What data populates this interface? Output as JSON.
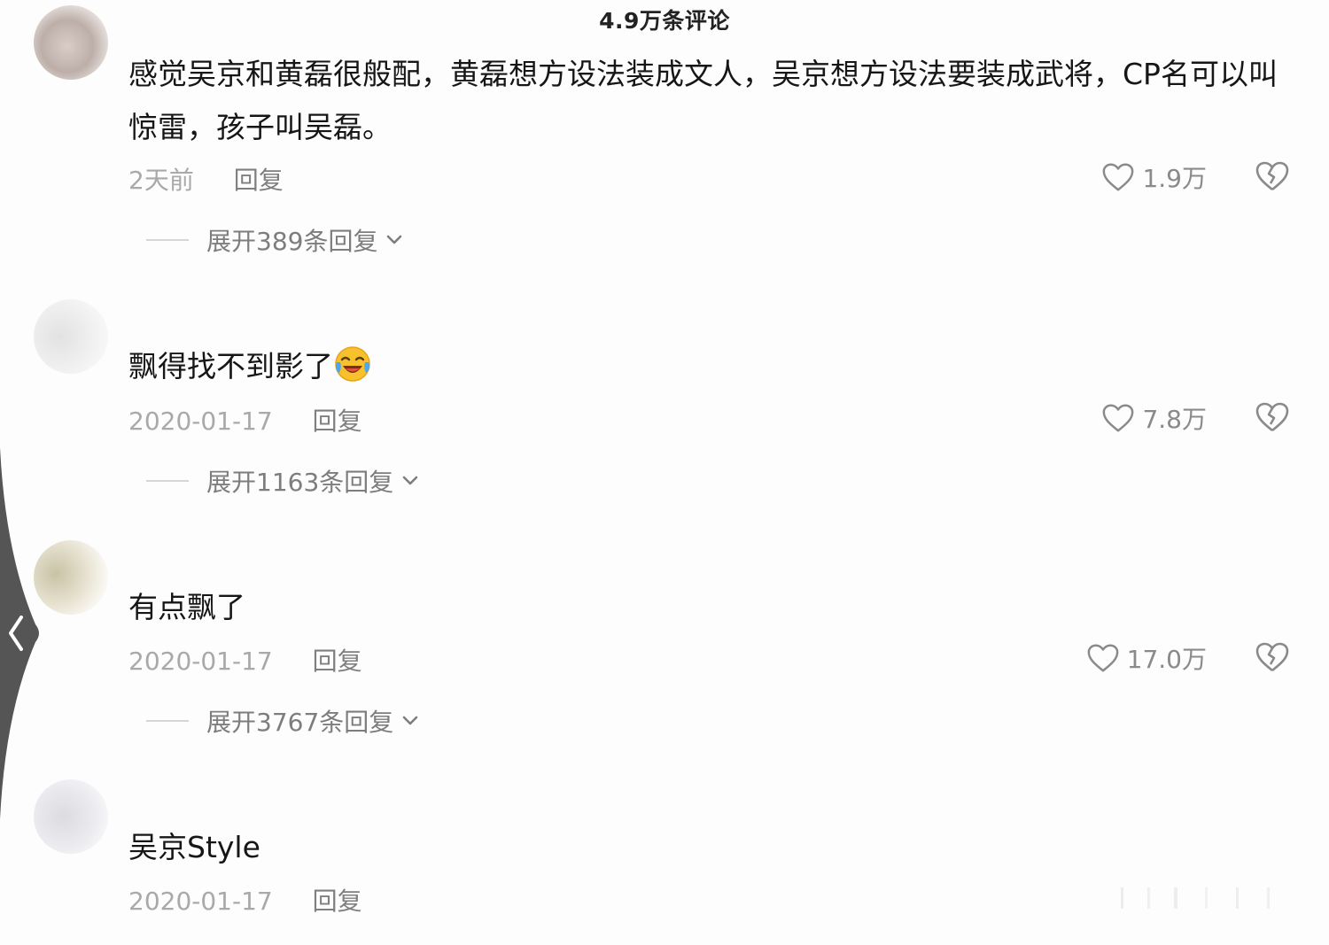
{
  "header": {
    "title": "4.9万条评论"
  },
  "comments": [
    {
      "text": "感觉吴京和黄磊很般配，黄磊想方设法装成文人，吴京想方设法要装成武将，CP名可以叫惊雷，孩子叫吴磊。",
      "date": "2天前",
      "reply_label": "回复",
      "likes": "1.9万",
      "expand_label": "展开389条回复"
    },
    {
      "text": "飘得找不到影了",
      "emoji": "laughing-crying-emoji",
      "date": "2020-01-17",
      "reply_label": "回复",
      "likes": "7.8万",
      "expand_label": "展开1163条回复"
    },
    {
      "text": "有点飘了",
      "date": "2020-01-17",
      "reply_label": "回复",
      "likes": "17.0万",
      "expand_label": "展开3767条回复"
    },
    {
      "text": "吴京Style",
      "date": "2020-01-17",
      "reply_label": "回复"
    }
  ],
  "icons": {
    "like": "heart-outline-icon",
    "dislike": "broken-heart-icon",
    "expand": "chevron-down-icon",
    "back": "chevron-left-icon"
  },
  "colors": {
    "background": "#fdfdfd",
    "text_primary": "#161616",
    "text_secondary": "#a9a9a9",
    "side_handle": "#555555"
  }
}
